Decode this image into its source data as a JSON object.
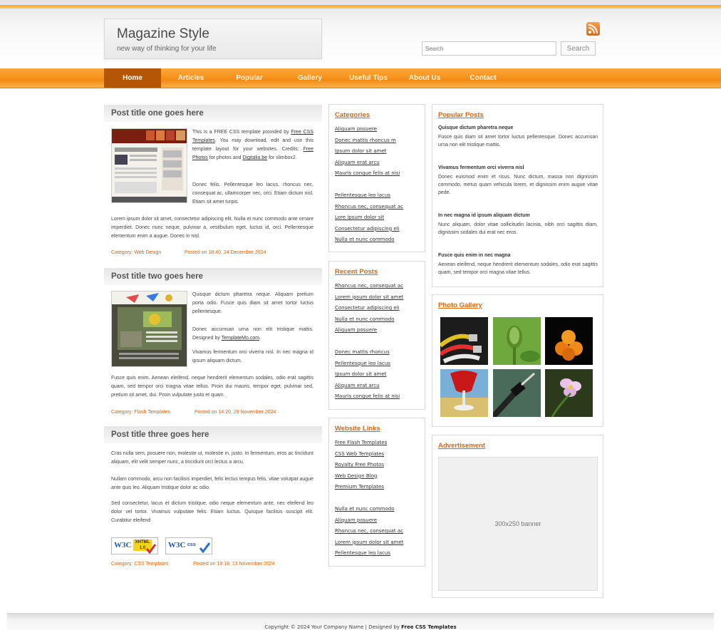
{
  "header": {
    "site_title": "Magazine Style",
    "slogan": "new way of thinking for your life",
    "search_placeholder": "Search",
    "search_button": "Search"
  },
  "nav": [
    "Home",
    "Articles",
    "Popular",
    "Gallery",
    "Useful Tips",
    "About Us",
    "Contact"
  ],
  "posts": [
    {
      "title": "Post title one goes here",
      "p1_pre": "This is a FREE CSS template provided by",
      "p1_link1": "Free CSS Templates",
      "p1_mid": ". You may download, edit and use this template layout for your websites. Credits:",
      "p1_link2": "Free Photos",
      "p1_mid2": "for photos and",
      "p1_link3": "Digitalia.be",
      "p1_post": "for slimbox2.",
      "p2": "Donec felis. Pellentesque leo lacus, rhoncus nec, consequat ac, ullamcorper nec, orci. Etiam dictum nisl. Etiam sit amet turpis.",
      "p3": "Lorem ipsum dolor sit amet, consectetur adipiscing elit. Nulla et nunc commodo ante ornare imperdiet. Donec nunc neque, pulvinar a, vestibulum eget, luctus id, orci. Pellentesque elementum enim a augue. Donec in nisl.",
      "category": "Category: Web Design",
      "posted": "Posted on 18:40, 24 December 2024"
    },
    {
      "title": "Post title two goes here",
      "p1": "Quisque dictum pharetra neque. Aliquam pretium porta odio. Fusce quis diam sit amet tortor luctus pellentesque.",
      "p2_pre": "Donec accumsan urna non elit tristique mattis. Designed by",
      "p2_link": "TemplateMo.com",
      "p2_post": ".",
      "p3": "Vivamus fermentum orci viverra nisl. In nec magna id ipsum aliquam dictum.",
      "p4": "Fusce quis enim. Aenean eleifend, neque hendrerit elementum sodales, odio erat sagittis quam, sed tempor orci magna vitae tellus. Proin dui mauris, tempor eget, pulvinar sed, pretium sit amet, dui. Proin vulputate justo et quam.",
      "category": "Category: Flash Templates",
      "posted": "Posted on 14:20, 29 November 2024"
    },
    {
      "title": "Post title three goes here",
      "p1": "Cras nulla sem, posuere non, molestie ut, molestie in, justo. In fermentum, eros ac tincidunt aliquam, elit velit semper nunc, a tincidunt orci lectus a arcu.",
      "p2": "Nullam commodo, arcu non facilisis imperdiet, felis lectus tempus felis, vitae volutpat augue ante quis leo. Aliquam tristique dolor ac odio.",
      "p3": "Sed consectetur, lacus et dictum tristique, odio neque elementum ante, nec eleifend leo dolor vel tortor. Vivamus vulputate felis. Etiam luctus. Quisque facilisis suscipit elit. Curabitur eleifend",
      "category": "Category: CSS Templates",
      "posted": "Posted on 19:18, 13 November 2024",
      "badge1_w3c": "W3C",
      "badge1_label": "XHTML 1.0",
      "badge2_w3c": "W3C",
      "badge2_label": "css"
    }
  ],
  "categories": {
    "title": "Categories",
    "items": [
      "Aliquam posuere",
      "Donec mattis rhoncus m",
      "Ipsum dolor sit amet",
      "Aliquam erat arcu",
      "Mauris congue felis at nisi",
      "Pellentesque leo lacus",
      "Rhoncus nec, consequat ac",
      "Lore ipsum dolor sit",
      "Consectetur adipiscing eli",
      "Nulla et nunc commodo"
    ]
  },
  "recent": {
    "title": "Recent Posts",
    "items": [
      "Rhoncus nec, consequat ac",
      "Lorem ipsum dolor sit amet",
      "Consectetur adipiscing eli",
      "Nulla et nunc commodo",
      "Aliquam posuere",
      "Donec mattis rhoncus",
      "Pellentesque leo lacus",
      "Ipsum dolor sit amet",
      "Aliquam erat arcu",
      "Mauris congue felis at nisi"
    ]
  },
  "links": {
    "title": "Website Links",
    "items": [
      "Free Flash Templates",
      "CSS Web Templates",
      "Royalty Free Photos",
      "Web Design Blog",
      "Premium Templates",
      "Nulla et nunc commodo",
      "Aliquam posuere",
      "Rhoncus nec, consequat ac",
      "Lorem ipsum dolor sit amet",
      "Pellentesque leo lacus"
    ]
  },
  "popular": {
    "title": "Popular Posts",
    "items": [
      {
        "title": "Quisque dictum pharetra neque",
        "text": "Fusce quis diam sit amet tortor luctus pellentesque. Donec accumsan urna non elit tristique mattis."
      },
      {
        "title": "Vivamus fermentum orci viverra nisl",
        "text": "Donec euismod enim et risus. Nunc dictum, massa non dignissim commodo, metus quam vehicula lorem, et dignissim enim augue vitae pede."
      },
      {
        "title": "In nec magna id ipsum aliquam dictum",
        "text": "Nunc aliquam, dolor vitae sollicitudin lacinia, nibh orci sagittis diam, dignissim sodales dui erat nec eros."
      },
      {
        "title": "Fusce quis enim in nec magna",
        "text": "Aenean eleifend, neque hendrerit elementum sodales, odio erat sagittis quam, sed tempor orci magna vitae tellus."
      }
    ]
  },
  "gallery": {
    "title": "Photo Gallery"
  },
  "ad": {
    "title": "Advertisement",
    "placeholder": "300x250 banner"
  },
  "footer": {
    "prefix": "Copyright © 2024 Your Company Name | Designed by",
    "link": "Free CSS Templates"
  },
  "colors": {
    "accent": "#f7941d",
    "nav_active": "#b45606",
    "link_orange": "#d96a10"
  }
}
